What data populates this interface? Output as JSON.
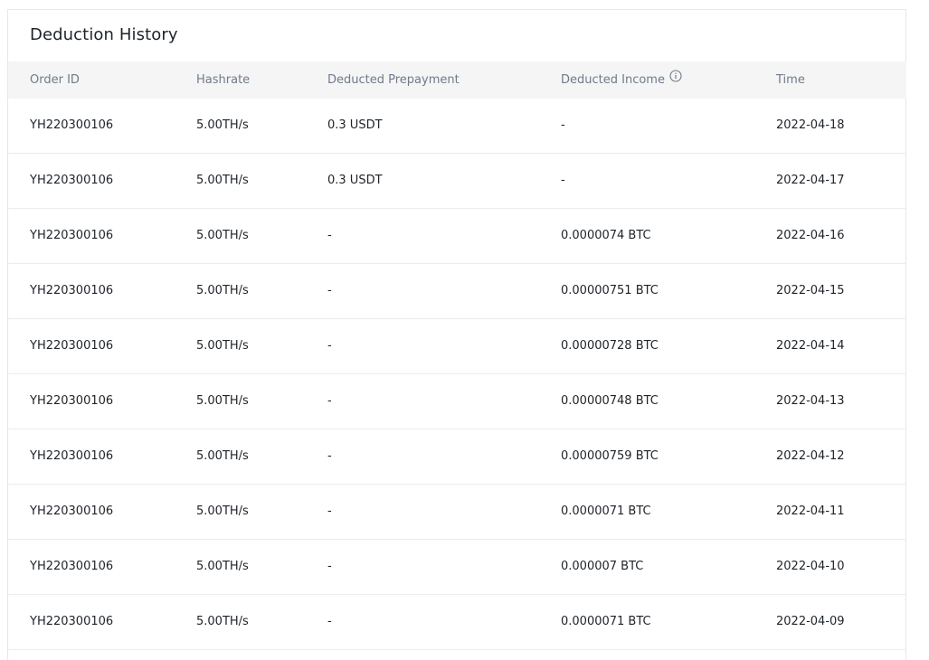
{
  "page": {
    "title": "Deduction History"
  },
  "table": {
    "headers": {
      "order_id": "Order ID",
      "hashrate": "Hashrate",
      "deducted_prepayment": "Deducted Prepayment",
      "deducted_income": "Deducted Income",
      "time": "Time"
    },
    "rows": [
      {
        "order_id": "YH220300106",
        "hashrate": "5.00TH/s",
        "deducted_prepayment": "0.3 USDT",
        "deducted_income": "-",
        "time": "2022-04-18"
      },
      {
        "order_id": "YH220300106",
        "hashrate": "5.00TH/s",
        "deducted_prepayment": "0.3 USDT",
        "deducted_income": "-",
        "time": "2022-04-17"
      },
      {
        "order_id": "YH220300106",
        "hashrate": "5.00TH/s",
        "deducted_prepayment": "-",
        "deducted_income": "0.0000074 BTC",
        "time": "2022-04-16"
      },
      {
        "order_id": "YH220300106",
        "hashrate": "5.00TH/s",
        "deducted_prepayment": "-",
        "deducted_income": "0.00000751 BTC",
        "time": "2022-04-15"
      },
      {
        "order_id": "YH220300106",
        "hashrate": "5.00TH/s",
        "deducted_prepayment": "-",
        "deducted_income": "0.00000728 BTC",
        "time": "2022-04-14"
      },
      {
        "order_id": "YH220300106",
        "hashrate": "5.00TH/s",
        "deducted_prepayment": "-",
        "deducted_income": "0.00000748 BTC",
        "time": "2022-04-13"
      },
      {
        "order_id": "YH220300106",
        "hashrate": "5.00TH/s",
        "deducted_prepayment": "-",
        "deducted_income": "0.00000759 BTC",
        "time": "2022-04-12"
      },
      {
        "order_id": "YH220300106",
        "hashrate": "5.00TH/s",
        "deducted_prepayment": "-",
        "deducted_income": "0.0000071 BTC",
        "time": "2022-04-11"
      },
      {
        "order_id": "YH220300106",
        "hashrate": "5.00TH/s",
        "deducted_prepayment": "-",
        "deducted_income": "0.000007 BTC",
        "time": "2022-04-10"
      },
      {
        "order_id": "YH220300106",
        "hashrate": "5.00TH/s",
        "deducted_prepayment": "-",
        "deducted_income": "0.0000071 BTC",
        "time": "2022-04-09"
      }
    ]
  },
  "icons": {
    "deducted_income_info": "info-circle-icon"
  },
  "colors": {
    "header_bg": "#f5f5f5",
    "header_text": "#707a8a",
    "body_text": "#1e2329",
    "divider": "#eaecef"
  }
}
